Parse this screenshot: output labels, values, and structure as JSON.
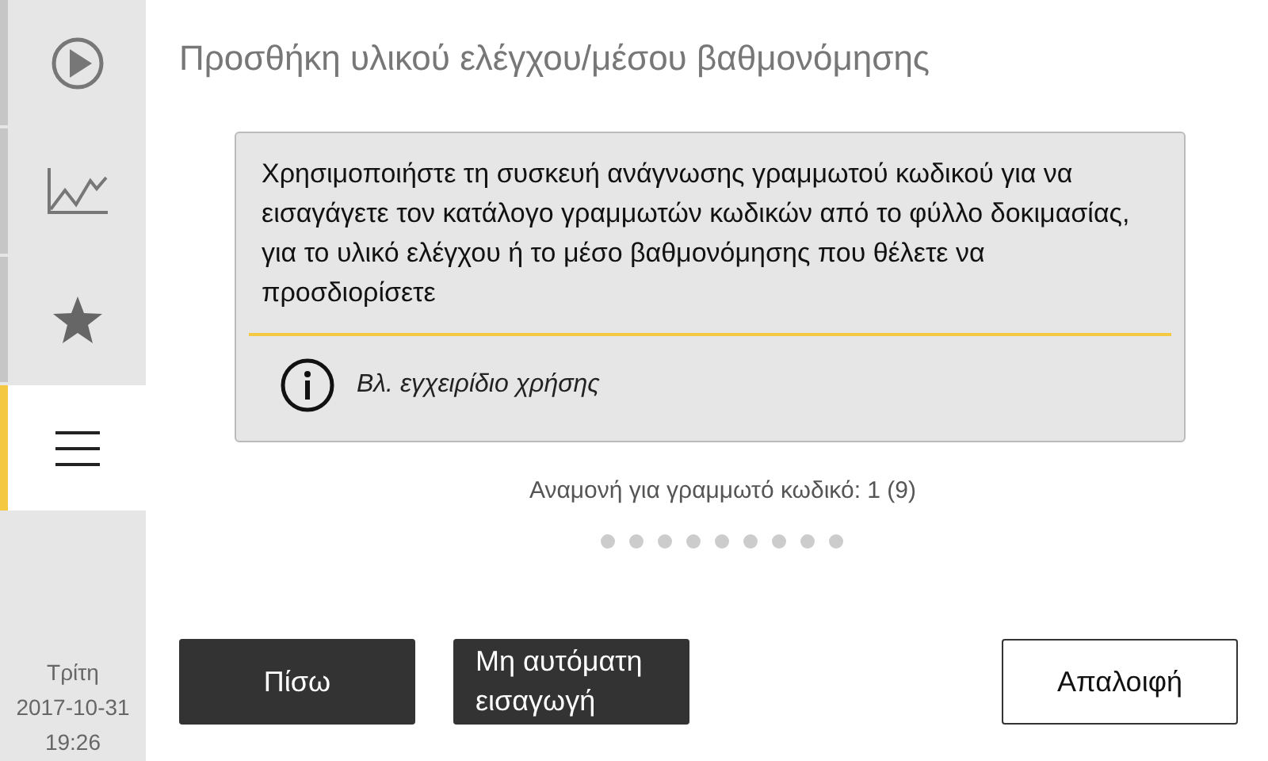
{
  "sidebar": {
    "items": [
      {
        "kind": "play",
        "selected": false
      },
      {
        "kind": "chart",
        "selected": false
      },
      {
        "kind": "star",
        "selected": false
      },
      {
        "kind": "menu",
        "selected": true
      }
    ],
    "day": "Τρίτη",
    "date": "2017-10-31",
    "time": "19:26"
  },
  "title": "Προσθήκη υλικού ελέγχου/μέσου βαθμονόμησης",
  "instruction": {
    "text": "Χρησιμοποιήστε τη συσκευή ανάγνωσης γραμμωτού κωδικού για να εισαγάγετε τον κατάλογο γραμμωτών κωδικών από το φύλλο δοκιμασίας, για το υλικό ελέγχου ή το μέσο βαθμονόμησης που θέλετε να προσδιορίσετε",
    "note": "Βλ. εγχειρίδιο χρήσης"
  },
  "status": "Αναμονή για γραμμωτό κωδικό: 1 (9)",
  "dots": [
    {
      "filled": false
    },
    {
      "filled": false
    },
    {
      "filled": false
    },
    {
      "filled": false
    },
    {
      "filled": false
    },
    {
      "filled": false
    },
    {
      "filled": false
    },
    {
      "filled": false
    },
    {
      "filled": false
    }
  ],
  "buttons": [
    {
      "label": "Πίσω",
      "kind": "dark"
    },
    {
      "label": "Μη αυτόματη εισαγωγή",
      "kind": "dark"
    },
    {
      "label": "Απαλοιφή",
      "kind": "outline"
    }
  ]
}
